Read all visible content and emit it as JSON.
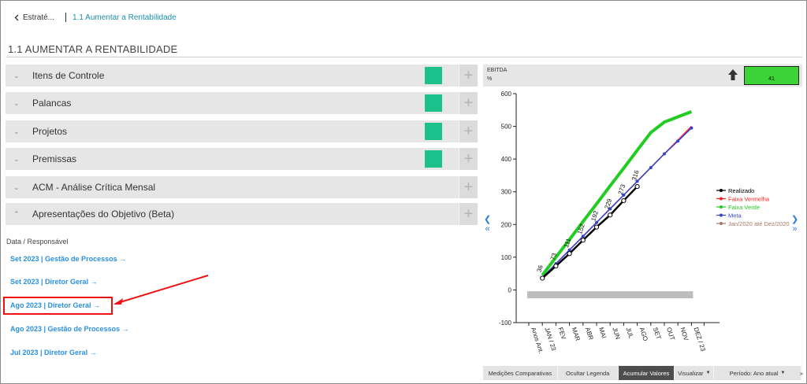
{
  "breadcrumb": {
    "back_label": "Estraté...",
    "current": "1.1 Aumentar a Rentabilidade"
  },
  "page_title": "1.1 AUMENTAR A RENTABILIDADE",
  "accordion": [
    {
      "label": "Itens de Controle",
      "has_status": true
    },
    {
      "label": "Palancas",
      "has_status": true
    },
    {
      "label": "Projetos",
      "has_status": true
    },
    {
      "label": "Premissas",
      "has_status": true
    },
    {
      "label": "ACM - Análise Crítica Mensal",
      "has_status": false
    },
    {
      "label": "Apresentações do Objetivo (Beta)",
      "has_status": false,
      "expanded": true
    }
  ],
  "presentations": {
    "header": "Data / Responsável",
    "links": [
      "Set 2023 | Gestão de Processos →",
      "Set 2023 | Diretor Geral →",
      "Ago 2023 | Diretor Geral →",
      "Ago 2023 | Gestão de Processos →",
      "Jul 2023 | Diretor Geral →"
    ],
    "highlighted_index": 2
  },
  "indicator": {
    "name": "EBITDA",
    "unit": "%",
    "value": "41",
    "trend_icon": "up-arrow-icon",
    "status_color": "#3bd336"
  },
  "colors": {
    "status_green": "#1cc08a",
    "link_blue": "#2a90e0",
    "crumb_teal": "#1a8fa8",
    "highlight_red": "#e11111"
  },
  "chart_data": {
    "type": "line",
    "categories": [
      "Anos Ant.",
      "JAN / 23",
      "FEV",
      "MAR",
      "ABR",
      "MAI",
      "JUN",
      "JUL",
      "AGO",
      "SET",
      "OUT",
      "NOV",
      "DEZ / 23"
    ],
    "ylim": [
      -100,
      600
    ],
    "yticks": [
      -100,
      0,
      100,
      200,
      300,
      400,
      500,
      600
    ],
    "grid": false,
    "legend_position": "right",
    "data_labels": [
      "36",
      "73",
      "111",
      "152",
      "192",
      "229",
      "273",
      "316"
    ],
    "series": [
      {
        "name": "Realizado",
        "color": "#000000",
        "values": [
          null,
          36,
          73,
          111,
          152,
          192,
          229,
          273,
          316,
          null,
          null,
          null,
          null
        ]
      },
      {
        "name": "Faixa Vermelha",
        "color": "#ff2222",
        "values": [
          null,
          38,
          80,
          122,
          164,
          206,
          248,
          290,
          332,
          374,
          416,
          458,
          500
        ]
      },
      {
        "name": "Faixa Verde",
        "color": "#22cc22",
        "values": [
          null,
          45,
          100,
          154,
          209,
          263,
          318,
          372,
          427,
          481,
          513,
          529,
          545
        ]
      },
      {
        "name": "Meta",
        "color": "#3344cc",
        "values": [
          null,
          38,
          80,
          122,
          164,
          206,
          248,
          290,
          332,
          374,
          416,
          455,
          495
        ]
      },
      {
        "name": "Jan/2020 até Dez/2020",
        "color": "#aa7766",
        "values": [
          -15,
          -15,
          -15,
          -15,
          -15,
          -15,
          -15,
          -15,
          -15,
          -15,
          -15,
          -15,
          -15
        ]
      }
    ]
  },
  "chart_tabs": [
    "Medições Comparativas",
    "Ocultar Legenda",
    "Acumular Valores",
    "Visualizar",
    "Período: Ano atual"
  ],
  "chart_tabs_active": 2
}
